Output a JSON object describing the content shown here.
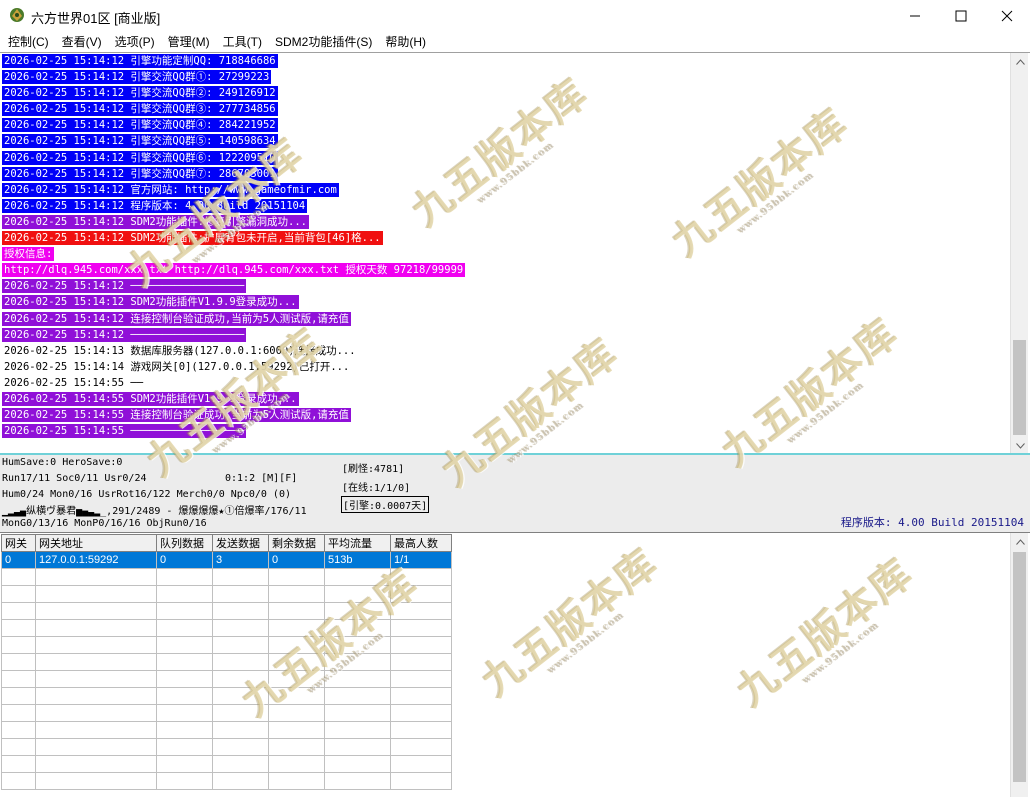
{
  "window": {
    "title": "六方世界01区 [商业版]"
  },
  "menu": [
    "控制(C)",
    "查看(V)",
    "选项(P)",
    "管理(M)",
    "工具(T)",
    "SDM2功能插件(S)",
    "帮助(H)"
  ],
  "colors": {
    "blue": "#0000f8",
    "red": "#f01010",
    "magenta": "#f000f0",
    "purple": "#9010d8",
    "selected_row": "#0078d7",
    "version_text": "#1a1a8a"
  },
  "log": [
    {
      "text": "2026-02-25 15:14:12 引擎功能定制QQ: 718846686",
      "bg": "#0000f8",
      "fg": "#ffffff"
    },
    {
      "text": "2026-02-25 15:14:12 引擎交流QQ群①: 27299223",
      "bg": "#0000f8",
      "fg": "#ffffff"
    },
    {
      "text": "2026-02-25 15:14:12 引擎交流QQ群②: 249126912",
      "bg": "#0000f8",
      "fg": "#ffffff"
    },
    {
      "text": "2026-02-25 15:14:12 引擎交流QQ群③: 277734856",
      "bg": "#0000f8",
      "fg": "#ffffff"
    },
    {
      "text": "2026-02-25 15:14:12 引擎交流QQ群④: 284221952",
      "bg": "#0000f8",
      "fg": "#ffffff"
    },
    {
      "text": "2026-02-25 15:14:12 引擎交流QQ群⑤: 140598634",
      "bg": "#0000f8",
      "fg": "#ffffff"
    },
    {
      "text": "2026-02-25 15:14:12 引擎交流QQ群⑥: 122209510",
      "bg": "#0000f8",
      "fg": "#ffffff"
    },
    {
      "text": "2026-02-25 15:14:12 引擎交流QQ群⑦: 286703001",
      "bg": "#0000f8",
      "fg": "#ffffff"
    },
    {
      "text": "2026-02-25 15:14:12 官方网站: http://www.gameofmir.com",
      "bg": "#0000f8",
      "fg": "#ffffff"
    },
    {
      "text": "2026-02-25 15:14:12 程序版本: 4.00 Build 20151104",
      "bg": "#0000f8",
      "fg": "#ffffff"
    },
    {
      "text": "2026-02-25 15:14:12 SDM2功能插件:修复引擎漏洞成功...",
      "bg": "#9010d8",
      "fg": "#ffffff"
    },
    {
      "text": "2026-02-25 15:14:12 SDM2功能插件:扩展背包未开启,当前背包[46]格...",
      "bg": "#f01010",
      "fg": "#ffffff"
    },
    {
      "text": "授权信息:",
      "bg": "#f000f0",
      "fg": "#ffffff"
    },
    {
      "text": "http://dlq.945.com/xxx.txt http://dlq.945.com/xxx.txt 授权天数 97218/99999",
      "bg": "#f000f0",
      "fg": "#ffffff"
    },
    {
      "text": "2026-02-25 15:14:12 ──────────────────",
      "bg": "#9010d8",
      "fg": "#ffffff"
    },
    {
      "text": "2026-02-25 15:14:12 SDM2功能插件V1.9.9登录成功...",
      "bg": "#9010d8",
      "fg": "#ffffff"
    },
    {
      "text": "2026-02-25 15:14:12 连接控制台验证成功,当前为5人测试版,请充值",
      "bg": "#9010d8",
      "fg": "#ffffff"
    },
    {
      "text": "2026-02-25 15:14:12 ──────────────────",
      "bg": "#9010d8",
      "fg": "#ffffff"
    },
    {
      "text": "2026-02-25 15:14:13 数据库服务器(127.0.0.1:6000)连接成功...",
      "bg": "transparent",
      "fg": "#000000"
    },
    {
      "text": "2026-02-25 15:14:14 游戏网关[0](127.0.0.1:59292)已打开...",
      "bg": "transparent",
      "fg": "#000000"
    },
    {
      "text": "2026-02-25 15:14:55 ──",
      "bg": "transparent",
      "fg": "#000000"
    },
    {
      "text": "2026-02-25 15:14:55 SDM2功能插件V1.9.9登录成功...",
      "bg": "#9010d8",
      "fg": "#ffffff"
    },
    {
      "text": "2026-02-25 15:14:55 连接控制台验证成功,当前为5人测试版,请充值",
      "bg": "#9010d8",
      "fg": "#ffffff"
    },
    {
      "text": "2026-02-25 15:14:55 ──────────────────",
      "bg": "#9010d8",
      "fg": "#ffffff"
    }
  ],
  "status": {
    "line1": "HumSave:0 HeroSave:0",
    "line2a": "Run17/11 Soc0/11 Usr0/24",
    "line2b": "0:1:2 [M][F]",
    "line3": "Hum0/24 Mon0/16 UsrRot16/122 Merch0/0 Npc0/0 (0)",
    "line4": "▁▂▃▄纵横ヴ暴君▅▄▃▂_,291/2489 - 爆爆爆爆★①倍爆率/176/11",
    "line5": "MonG0/13/16 MonP0/16/16 ObjRun0/16",
    "refresh": "[刷怪:4781]",
    "online": "[在线:1/1/0]",
    "engine": "[引擎:0.0007天]",
    "version": "程序版本: 4.00 Build 20151104"
  },
  "grid": {
    "headers": [
      "网关",
      "网关地址",
      "队列数据",
      "发送数据",
      "剩余数据",
      "平均流量",
      "最高人数"
    ],
    "rows": [
      [
        "0",
        "127.0.0.1:59292",
        "0",
        "3",
        "0",
        "513b",
        "1/1"
      ]
    ]
  },
  "watermark": {
    "text": "九五版本库",
    "sub": "www.95bbk.com"
  }
}
